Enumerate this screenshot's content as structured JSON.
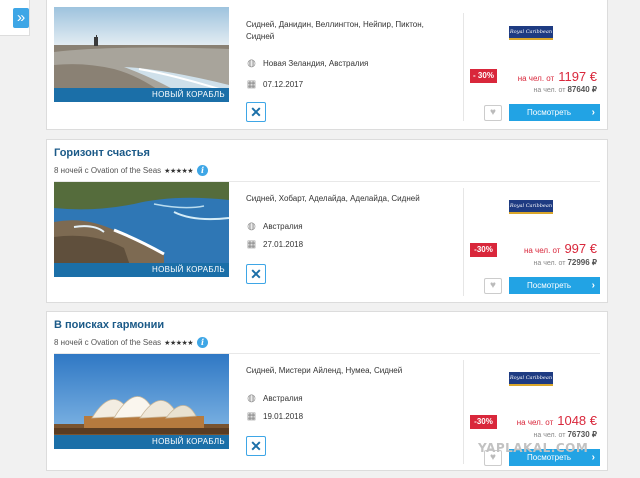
{
  "sidebar": {
    "toggle_icon": "double-chevron-right-icon",
    "toggle_label": "»"
  },
  "cruises": [
    {
      "title": "",
      "nights_ship": "",
      "stars": "",
      "photo_label": "НОВЫЙ КОРАБЛЬ",
      "route": "Сидней, Данидин, Веллингтон, Нейпир, Пиктон, Сидней",
      "region": "Новая Зеландия, Австралия",
      "date": "07.12.2017",
      "cruise_line_logo": "Royal Caribbean",
      "discount": "- 30%",
      "price_per_label": "на чел. от",
      "price": "1197 €",
      "old_price_label": "на чел. от",
      "old_price": "87640 ₽",
      "view_label": "Посмотреть"
    },
    {
      "title": "Горизонт счастья",
      "nights_ship": "8 ночей с Ovation of the Seas",
      "stars": "★★★★★",
      "photo_label": "НОВЫЙ КОРАБЛЬ",
      "route": "Сидней, Хобарт, Аделайда, Аделайда, Сидней",
      "region": "Австралия",
      "date": "27.01.2018",
      "cruise_line_logo": "Royal Caribbean",
      "discount": "-30%",
      "price_per_label": "на чел. от",
      "price": "997 €",
      "old_price_label": "на чел. от",
      "old_price": "72996 ₽",
      "view_label": "Посмотреть"
    },
    {
      "title": "В поисках гармонии",
      "nights_ship": "8 ночей с Ovation of the Seas",
      "stars": "★★★★★",
      "photo_label": "НОВЫЙ КОРАБЛЬ",
      "route": "Сидней, Мистери Айленд, Нумеа, Сидней",
      "region": "Австралия",
      "date": "19.01.2018",
      "cruise_line_logo": "Royal Caribbean",
      "discount": "-30%",
      "price_per_label": "на чел. от",
      "price": "1048 €",
      "old_price_label": "на чел. от",
      "old_price": "76730 ₽",
      "view_label": "Посмотреть"
    }
  ],
  "icons": {
    "globe": "globe-icon",
    "calendar": "calendar-icon",
    "cancel": "cancel-cross-icon",
    "heart": "heart-icon",
    "info": "info-icon",
    "chevron": "chevron-right-icon"
  },
  "watermark": "YAPLAKAL.COM",
  "colors": {
    "title_blue": "#1b5a88",
    "accent_blue": "#22a3e4",
    "discount_red": "#d9273b",
    "label_bar": "#1b6fa8"
  }
}
